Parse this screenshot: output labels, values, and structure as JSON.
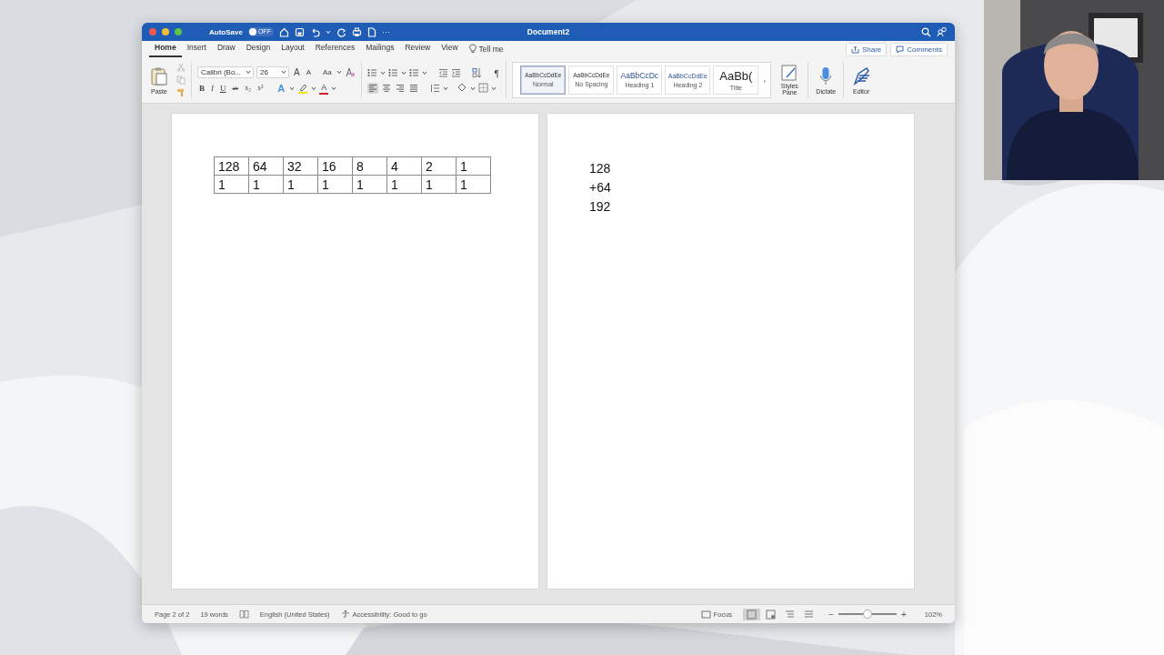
{
  "window": {
    "title": "Document2",
    "autosave_label": "AutoSave",
    "autosave": {
      "on": false,
      "state_label": "OFF"
    },
    "more": "···"
  },
  "tabs": [
    {
      "label": "Home",
      "selected": true
    },
    {
      "label": "Insert",
      "selected": false
    },
    {
      "label": "Draw",
      "selected": false
    },
    {
      "label": "Design",
      "selected": false
    },
    {
      "label": "Layout",
      "selected": false
    },
    {
      "label": "References",
      "selected": false
    },
    {
      "label": "Mailings",
      "selected": false
    },
    {
      "label": "Review",
      "selected": false
    },
    {
      "label": "View",
      "selected": false
    }
  ],
  "tell_me": "Tell me",
  "share": "Share",
  "comments": "Comments",
  "ribbon": {
    "paste": "Paste",
    "font": "Calibri (Bo...",
    "size": "26",
    "size_buttons": [
      {
        "label": "A",
        "kind": "grow"
      },
      {
        "label": "A",
        "kind": "shrink"
      }
    ],
    "case_button": "Aa",
    "format_buttons": [
      {
        "label": "B",
        "kind": "bold"
      },
      {
        "label": "I",
        "kind": "italic"
      },
      {
        "label": "U",
        "kind": "underline"
      },
      {
        "label": "ab",
        "kind": "strike"
      },
      {
        "label": "x₂",
        "kind": "sub"
      },
      {
        "label": "x²",
        "kind": "sup"
      }
    ],
    "color_buttons": [
      {
        "label": "A",
        "kind": "effects"
      },
      {
        "kind": "highlight",
        "color": "#f5e50c"
      },
      {
        "label": "A",
        "kind": "font_color",
        "color": "#d0202a"
      }
    ],
    "pilcrow": "¶",
    "alignment": [
      {
        "kind": "left",
        "selected": true
      },
      {
        "kind": "center",
        "selected": false
      },
      {
        "kind": "right",
        "selected": false
      },
      {
        "kind": "justify",
        "selected": false
      }
    ],
    "styles": [
      {
        "sample": "AaBbCcDdEe",
        "name": "Normal",
        "kind": "normal",
        "selected": true
      },
      {
        "sample": "AaBbCcDdEe",
        "name": "No Spacing",
        "kind": "normal",
        "selected": false
      },
      {
        "sample": "AaBbCcDc",
        "name": "Heading 1",
        "kind": "heading1",
        "selected": false
      },
      {
        "sample": "AaBbCcDdEe",
        "name": "Heading 2",
        "kind": "heading2",
        "selected": false
      },
      {
        "sample": "AaBb(",
        "name": "Title",
        "kind": "title",
        "selected": false
      }
    ],
    "gallery_more": "›",
    "styles_pane": "Styles Pane",
    "dictate": "Dictate",
    "editor": "Editor"
  },
  "pages": [
    {
      "kind": "table",
      "rows": [
        [
          "128",
          "64",
          "32",
          "16",
          "8",
          "4",
          "2",
          "1"
        ],
        [
          "1",
          "1",
          "1",
          "1",
          "1",
          "1",
          "1",
          "1"
        ]
      ]
    },
    {
      "kind": "lines",
      "lines": [
        "128",
        "+64",
        "192"
      ]
    }
  ],
  "status_bar": {
    "page": "Page 2 of 2",
    "words": "19 words",
    "language": "English (United States)",
    "accessibility": "Accessibility: Good to go",
    "focus": "Focus",
    "views": [
      {
        "kind": "print",
        "selected": true
      },
      {
        "kind": "web",
        "selected": false
      },
      {
        "kind": "outline",
        "selected": false
      },
      {
        "kind": "draft",
        "selected": false
      }
    ],
    "zoom_out": "−",
    "zoom_in": "+",
    "zoom_slider": {
      "level": 0.5
    },
    "zoom": "102%"
  }
}
